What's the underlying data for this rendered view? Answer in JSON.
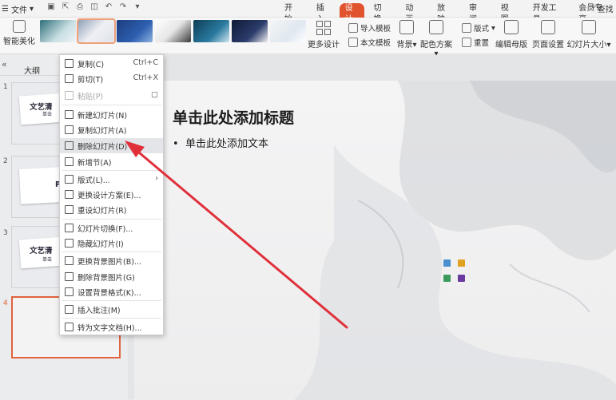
{
  "topbar": {
    "file_label": "文件",
    "tabs": [
      "开始",
      "插入",
      "设计",
      "切换",
      "动画",
      "放映",
      "审阅",
      "视图",
      "开发工具",
      "会员专享"
    ],
    "active_tab": "设计",
    "search_label": "查找"
  },
  "ribbon": {
    "smart_beautify": "智能美化",
    "more_designs": "更多设计",
    "import_template": "导入模板",
    "body_template": "本文模板",
    "background": "背景",
    "color_scheme": "配色方案",
    "format": "版式",
    "reset": "重置",
    "edit_master": "编辑母版",
    "page_setup": "页面设置",
    "slide_size": "幻灯片大小"
  },
  "leftpane": {
    "outline_tab": "大纲",
    "slides": [
      {
        "num": "1",
        "title": "文艺清",
        "sub": "单击"
      },
      {
        "num": "2",
        "title": "P"
      },
      {
        "num": "3",
        "title": "文艺清",
        "sub": "单击"
      },
      {
        "num": "4"
      }
    ]
  },
  "slide": {
    "title": "单击此处添加标题",
    "body": "单击此处添加文本"
  },
  "context_menu": {
    "items": [
      {
        "label": "复制(C)",
        "shortcut": "Ctrl+C"
      },
      {
        "label": "剪切(T)",
        "shortcut": "Ctrl+X"
      },
      {
        "label": "粘贴(P)"
      },
      {
        "label": "新建幻灯片(N)"
      },
      {
        "label": "复制幻灯片(A)"
      },
      {
        "label": "删除幻灯片(D)"
      },
      {
        "label": "新增节(A)"
      },
      {
        "label": "版式(L)..."
      },
      {
        "label": "更换设计方案(E)..."
      },
      {
        "label": "重设幻灯片(R)"
      },
      {
        "label": "幻灯片切换(F)..."
      },
      {
        "label": "隐藏幻灯片(I)"
      },
      {
        "label": "更换背景图片(B)..."
      },
      {
        "label": "删除背景图片(G)"
      },
      {
        "label": "设置背景格式(K)..."
      },
      {
        "label": "插入批注(M)"
      },
      {
        "label": "转为文字文档(H)..."
      }
    ]
  },
  "colors": {
    "accent": "#e0532e",
    "arrow": "#e0303a",
    "highlight": "#e3e5e8"
  }
}
